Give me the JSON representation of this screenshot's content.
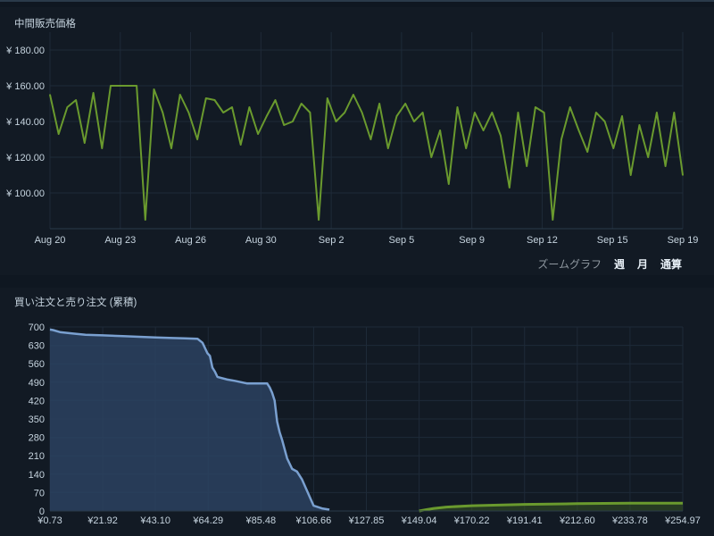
{
  "price_chart": {
    "title": "中間販売価格",
    "y_ticks": [
      "¥ 180.00",
      "¥ 160.00",
      "¥ 140.00",
      "¥ 120.00",
      "¥ 100.00"
    ],
    "x_ticks": [
      "Aug 20",
      "Aug 23",
      "Aug 26",
      "Aug 30",
      "Sep 2",
      "Sep 5",
      "Sep 9",
      "Sep 12",
      "Sep 15",
      "Sep 19"
    ],
    "line_color": "#6a9a2e"
  },
  "zoom": {
    "label": "ズームグラフ",
    "week": "週",
    "month": "月",
    "all": "通算"
  },
  "depth_chart": {
    "title": "買い注文と売り注文 (累積)",
    "y_ticks": [
      "700",
      "630",
      "560",
      "490",
      "420",
      "350",
      "280",
      "210",
      "140",
      "70",
      "0"
    ],
    "x_ticks": [
      "¥0.73",
      "¥21.92",
      "¥43.10",
      "¥64.29",
      "¥85.48",
      "¥106.66",
      "¥127.85",
      "¥149.04",
      "¥170.22",
      "¥191.41",
      "¥212.60",
      "¥233.78",
      "¥254.97"
    ],
    "buy_color": "#7aa0d0",
    "sell_color": "#6a9a2e"
  },
  "chart_data": [
    {
      "type": "line",
      "title": "中間販売価格",
      "xlabel": "",
      "ylabel": "",
      "ylim": [
        80,
        190
      ],
      "x": [
        "Aug 20",
        "Aug 20",
        "Aug 21",
        "Aug 21",
        "Aug 21",
        "Aug 21",
        "Aug 21",
        "Aug 22",
        "Aug 22",
        "Aug 22",
        "Aug 22",
        "Aug 23",
        "Aug 23",
        "Aug 24",
        "Aug 24",
        "Aug 24",
        "Aug 25",
        "Aug 25",
        "Aug 25",
        "Aug 26",
        "Aug 26",
        "Aug 27",
        "Aug 27",
        "Aug 28",
        "Aug 28",
        "Aug 28",
        "Aug 29",
        "Aug 29",
        "Aug 30",
        "Aug 30",
        "Aug 31",
        "Aug 31",
        "Aug 31",
        "Sep 1",
        "Sep 1",
        "Sep 1",
        "Sep 2",
        "Sep 2",
        "Sep 3",
        "Sep 3",
        "Sep 3",
        "Sep 4",
        "Sep 4",
        "Sep 5",
        "Sep 5",
        "Sep 6",
        "Sep 6",
        "Sep 7",
        "Sep 7",
        "Sep 7",
        "Sep 8",
        "Sep 8",
        "Sep 9",
        "Sep 9",
        "Sep 10",
        "Sep 10",
        "Sep 10",
        "Sep 11",
        "Sep 11",
        "Sep 11",
        "Sep 12",
        "Sep 13",
        "Sep 13",
        "Sep 14",
        "Sep 15",
        "Sep 15",
        "Sep 16",
        "Sep 16",
        "Sep 17",
        "Sep 17",
        "Sep 18",
        "Sep 18",
        "Sep 19",
        "Sep 19"
      ],
      "values": [
        155,
        133,
        148,
        152,
        128,
        156,
        125,
        160,
        160,
        160,
        160,
        85,
        158,
        145,
        125,
        155,
        145,
        130,
        153,
        152,
        145,
        148,
        127,
        148,
        133,
        143,
        152,
        138,
        140,
        150,
        145,
        85,
        153,
        140,
        145,
        155,
        145,
        130,
        150,
        125,
        143,
        150,
        140,
        145,
        120,
        135,
        105,
        148,
        125,
        145,
        135,
        145,
        132,
        103,
        145,
        115,
        148,
        145,
        85,
        130,
        148,
        135,
        123,
        145,
        140,
        125,
        143,
        110,
        138,
        120,
        145,
        115,
        145,
        110
      ],
      "series": [
        {
          "values": "see values"
        }
      ]
    },
    {
      "type": "area",
      "title": "買い注文と売り注文 (累積)",
      "xlabel": "",
      "ylabel": "",
      "ylim": [
        0,
        700
      ],
      "x": [
        0.73,
        2,
        5,
        10,
        15,
        21.92,
        30,
        43.1,
        50,
        55,
        60,
        62,
        64,
        65,
        66,
        67,
        68,
        72,
        75,
        80,
        85.48,
        88,
        89,
        90,
        91,
        92,
        93,
        94,
        96,
        98,
        100,
        102,
        106.66,
        110,
        113
      ],
      "series": [
        {
          "name": "buy",
          "values": [
            690,
            688,
            680,
            675,
            670,
            668,
            665,
            660,
            658,
            657,
            655,
            640,
            600,
            590,
            545,
            530,
            510,
            500,
            495,
            485,
            485,
            485,
            470,
            450,
            420,
            340,
            300,
            270,
            200,
            160,
            150,
            120,
            20,
            10,
            5
          ]
        },
        {
          "name": "sell",
          "x": [
            149.04,
            152,
            155,
            160,
            170.22,
            191.41,
            212.6,
            233.78,
            254.97
          ],
          "values": [
            0,
            5,
            10,
            15,
            20,
            25,
            28,
            30,
            30
          ]
        }
      ]
    }
  ]
}
